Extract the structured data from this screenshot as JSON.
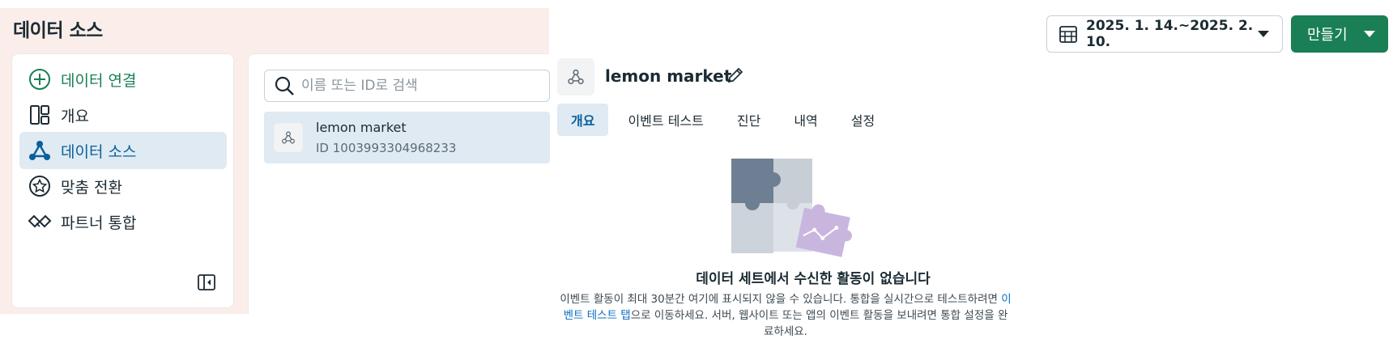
{
  "page_title": "데이터 소스",
  "sidebar": {
    "items": [
      {
        "label": "데이터 연결",
        "icon": "plus-circle-icon"
      },
      {
        "label": "개요",
        "icon": "layout-icon"
      },
      {
        "label": "데이터 소스",
        "icon": "data-source-icon",
        "active": true
      },
      {
        "label": "맞춤 전환",
        "icon": "star-badge-icon"
      },
      {
        "label": "파트너 통합",
        "icon": "handshake-icon"
      }
    ],
    "collapse_icon": "sidebar-collapse-icon"
  },
  "search": {
    "placeholder": "이름 또는 ID로 검색"
  },
  "data_sources": [
    {
      "name": "lemon market",
      "id_text": "ID 1003993304968233"
    }
  ],
  "header": {
    "date_range": "2025. 1. 14.~2025. 2. 10.",
    "create_label": "만들기"
  },
  "detail": {
    "title": "lemon market",
    "tabs": [
      "개요",
      "이벤트 테스트",
      "진단",
      "내역",
      "설정"
    ],
    "active_tab": 0,
    "empty_title": "데이터 세트에서 수신한 활동이 없습니다",
    "empty_desc_1": "이벤트 활동이 최대 30분간 여기에 표시되지 않을 수 있습니다. 통합을 실시간으로 테스트하려면",
    "empty_desc_link": "이벤트 테스트 탭",
    "empty_desc_2": "으로 이동하세요. 서버, 웹사이트 또는 앱의 이벤트 활동을 보내려면 통합 설정을 완료하세요."
  },
  "colors": {
    "brand_green": "#1a7f54",
    "active_blue": "#0a5f99",
    "active_bg": "#dfeaf3",
    "link": "#0a6dc2"
  }
}
